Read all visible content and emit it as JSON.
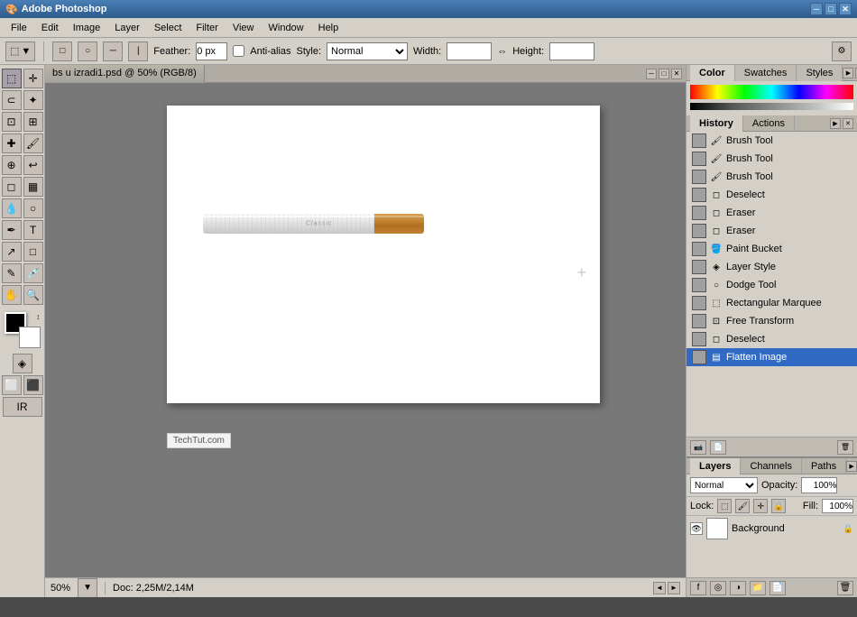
{
  "app": {
    "title": "Adobe Photoshop",
    "title_icon": "🎨"
  },
  "title_bar": {
    "label": "Adobe Photoshop",
    "min_btn": "─",
    "max_btn": "□",
    "close_btn": "✕"
  },
  "menu": {
    "items": [
      "File",
      "Edit",
      "Image",
      "Layer",
      "Select",
      "Filter",
      "View",
      "Window",
      "Help"
    ]
  },
  "options_bar": {
    "feather_label": "Feather:",
    "feather_value": "0 px",
    "anti_alias_label": "Anti-alias",
    "style_label": "Style:",
    "style_value": "Normal",
    "width_label": "Width:",
    "height_label": "Height:"
  },
  "document": {
    "tab_title": "bs u izradi1.psd @ 50% (RGB/8)",
    "zoom": "50%",
    "doc_info": "Doc: 2,25M/2,14M"
  },
  "toolbox": {
    "tools": [
      {
        "name": "marquee-tool",
        "icon": "⬚",
        "active": true
      },
      {
        "name": "move-tool",
        "icon": "✛"
      },
      {
        "name": "lasso-tool",
        "icon": "⊂"
      },
      {
        "name": "magic-wand-tool",
        "icon": "✦"
      },
      {
        "name": "crop-tool",
        "icon": "⊡"
      },
      {
        "name": "slice-tool",
        "icon": "⊞"
      },
      {
        "name": "healing-tool",
        "icon": "✚"
      },
      {
        "name": "brush-tool",
        "icon": "🖌"
      },
      {
        "name": "clone-tool",
        "icon": "⊕"
      },
      {
        "name": "history-brush-tool",
        "icon": "↩"
      },
      {
        "name": "eraser-tool",
        "icon": "◻"
      },
      {
        "name": "gradient-tool",
        "icon": "▦"
      },
      {
        "name": "blur-tool",
        "icon": "💧"
      },
      {
        "name": "dodge-tool",
        "icon": "○"
      },
      {
        "name": "pen-tool",
        "icon": "✒"
      },
      {
        "name": "text-tool",
        "icon": "T"
      },
      {
        "name": "path-selection-tool",
        "icon": "↗"
      },
      {
        "name": "shape-tool",
        "icon": "□"
      },
      {
        "name": "notes-tool",
        "icon": "✎"
      },
      {
        "name": "eyedropper-tool",
        "icon": "💉"
      },
      {
        "name": "hand-tool",
        "icon": "✋"
      },
      {
        "name": "zoom-tool",
        "icon": "🔍"
      }
    ]
  },
  "color_panel": {
    "title": "Color",
    "tabs": [
      "Color",
      "Swatches",
      "Styles"
    ]
  },
  "history_panel": {
    "title": "History",
    "tabs": [
      "History",
      "Actions"
    ],
    "items": [
      {
        "label": "Brush Tool",
        "icon": "🖌",
        "active": false
      },
      {
        "label": "Brush Tool",
        "icon": "🖌",
        "active": false
      },
      {
        "label": "Brush Tool",
        "icon": "🖌",
        "active": false
      },
      {
        "label": "Deselect",
        "icon": "◻",
        "active": false
      },
      {
        "label": "Eraser",
        "icon": "◻",
        "active": false
      },
      {
        "label": "Eraser",
        "icon": "◻",
        "active": false
      },
      {
        "label": "Paint Bucket",
        "icon": "🪣",
        "active": false
      },
      {
        "label": "Layer Style",
        "icon": "◈",
        "active": false
      },
      {
        "label": "Dodge Tool",
        "icon": "○",
        "active": false
      },
      {
        "label": "Rectangular Marquee",
        "icon": "⬚",
        "active": false
      },
      {
        "label": "Free Transform",
        "icon": "⊡",
        "active": false
      },
      {
        "label": "Deselect",
        "icon": "◻",
        "active": false
      },
      {
        "label": "Flatten Image",
        "icon": "▤",
        "active": true
      }
    ]
  },
  "layers_panel": {
    "title": "Layers",
    "tabs": [
      "Layers",
      "Channels",
      "Paths"
    ],
    "blend_mode": "Normal",
    "opacity": "100%",
    "fill": "100%",
    "lock_label": "Lock:",
    "layers": [
      {
        "name": "Background",
        "visible": true,
        "locked": true,
        "active": false
      }
    ]
  },
  "crosshair": "+"
}
